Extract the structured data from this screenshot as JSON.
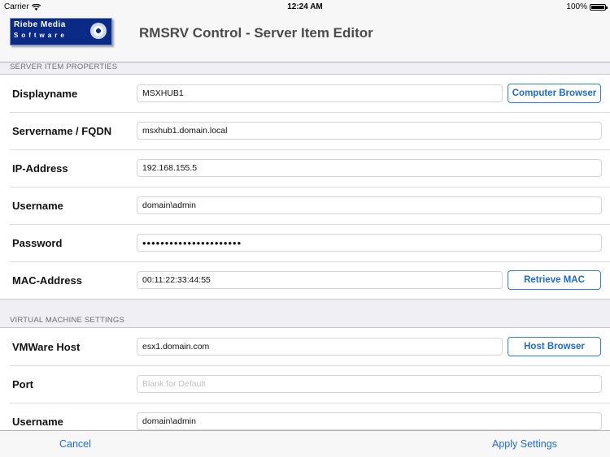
{
  "status_bar": {
    "carrier": "Carrier",
    "time": "12:24 AM",
    "battery": "100%",
    "battery_level": 1.0
  },
  "nav": {
    "logo_line1": "Riebe Media",
    "logo_line2": "Software",
    "title": "RMSRV Control - Server Item Editor"
  },
  "server_section": {
    "header": "SERVER ITEM PROPERTIES",
    "rows": {
      "displayname": {
        "label": "Displayname",
        "value": "MSXHUB1",
        "button": "Computer Browser"
      },
      "servername": {
        "label": "Servername / FQDN",
        "value": "msxhub1.domain.local"
      },
      "ip": {
        "label": "IP-Address",
        "value": "192.168.155.5"
      },
      "username": {
        "label": "Username",
        "value": "domain\\admin"
      },
      "password": {
        "label": "Password",
        "value": "••••••••••••••••••••••"
      },
      "mac": {
        "label": "MAC-Address",
        "value": "00:11:22:33:44:55",
        "button": "Retrieve MAC"
      }
    }
  },
  "vm_section": {
    "header": "VIRTUAL MACHINE SETTINGS",
    "rows": {
      "vmhost": {
        "label": "VMWare Host",
        "value": "esx1.domain.com",
        "button": "Host Browser"
      },
      "port": {
        "label": "Port",
        "placeholder": "Blank for Default"
      },
      "username": {
        "label": "Username",
        "value": "domain\\admin"
      }
    }
  },
  "toolbar": {
    "cancel": "Cancel",
    "apply": "Apply Settings"
  },
  "colors": {
    "accent": "#1d6bd6",
    "logo_bg": "#0b2a86",
    "background": "#efeff4"
  }
}
